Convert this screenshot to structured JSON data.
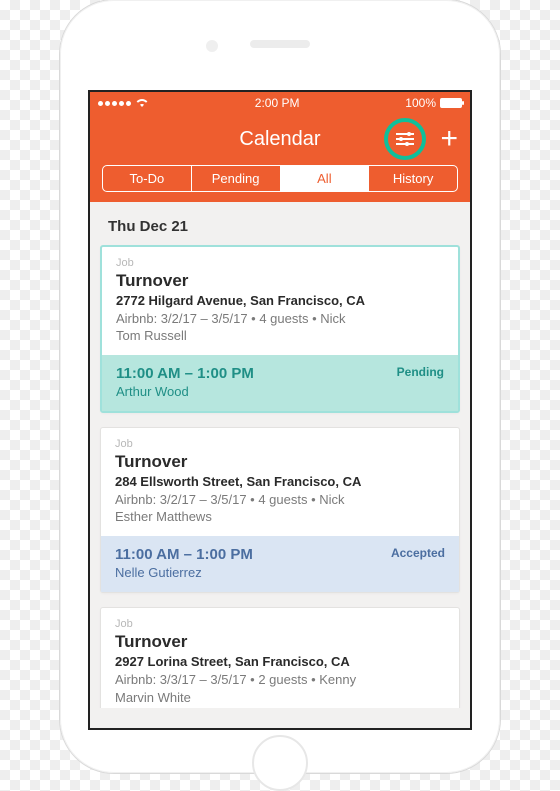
{
  "status_bar": {
    "time": "2:00 PM",
    "battery_pct": "100%"
  },
  "nav": {
    "title": "Calendar"
  },
  "tabs": {
    "todo": "To-Do",
    "pending": "Pending",
    "all": "All",
    "history": "History",
    "active": "all"
  },
  "date_header": "Thu  Dec 21",
  "jobs": [
    {
      "tag": "Job",
      "title": "Turnover",
      "address": "2772 Hilgard Avenue, San Francisco, CA",
      "meta": "Airbnb: 3/2/17 – 3/5/17 • 4 guests • Nick",
      "host": "Tom Russell",
      "time": "11:00 AM – 1:00 PM",
      "assignee": "Arthur Wood",
      "status": "Pending",
      "status_kind": "pending"
    },
    {
      "tag": "Job",
      "title": "Turnover",
      "address": "284 Ellsworth Street, San Francisco, CA",
      "meta": "Airbnb: 3/2/17 – 3/5/17 • 4 guests • Nick",
      "host": "Esther Matthews",
      "time": "11:00 AM – 1:00 PM",
      "assignee": "Nelle Gutierrez",
      "status": "Accepted",
      "status_kind": "accepted"
    },
    {
      "tag": "Job",
      "title": "Turnover",
      "address": "2927 Lorina Street, San Francisco, CA",
      "meta": "Airbnb: 3/3/17 – 3/5/17 • 2 guests • Kenny",
      "host": "Marvin White",
      "time": "",
      "assignee": "",
      "status": "",
      "status_kind": ""
    }
  ]
}
